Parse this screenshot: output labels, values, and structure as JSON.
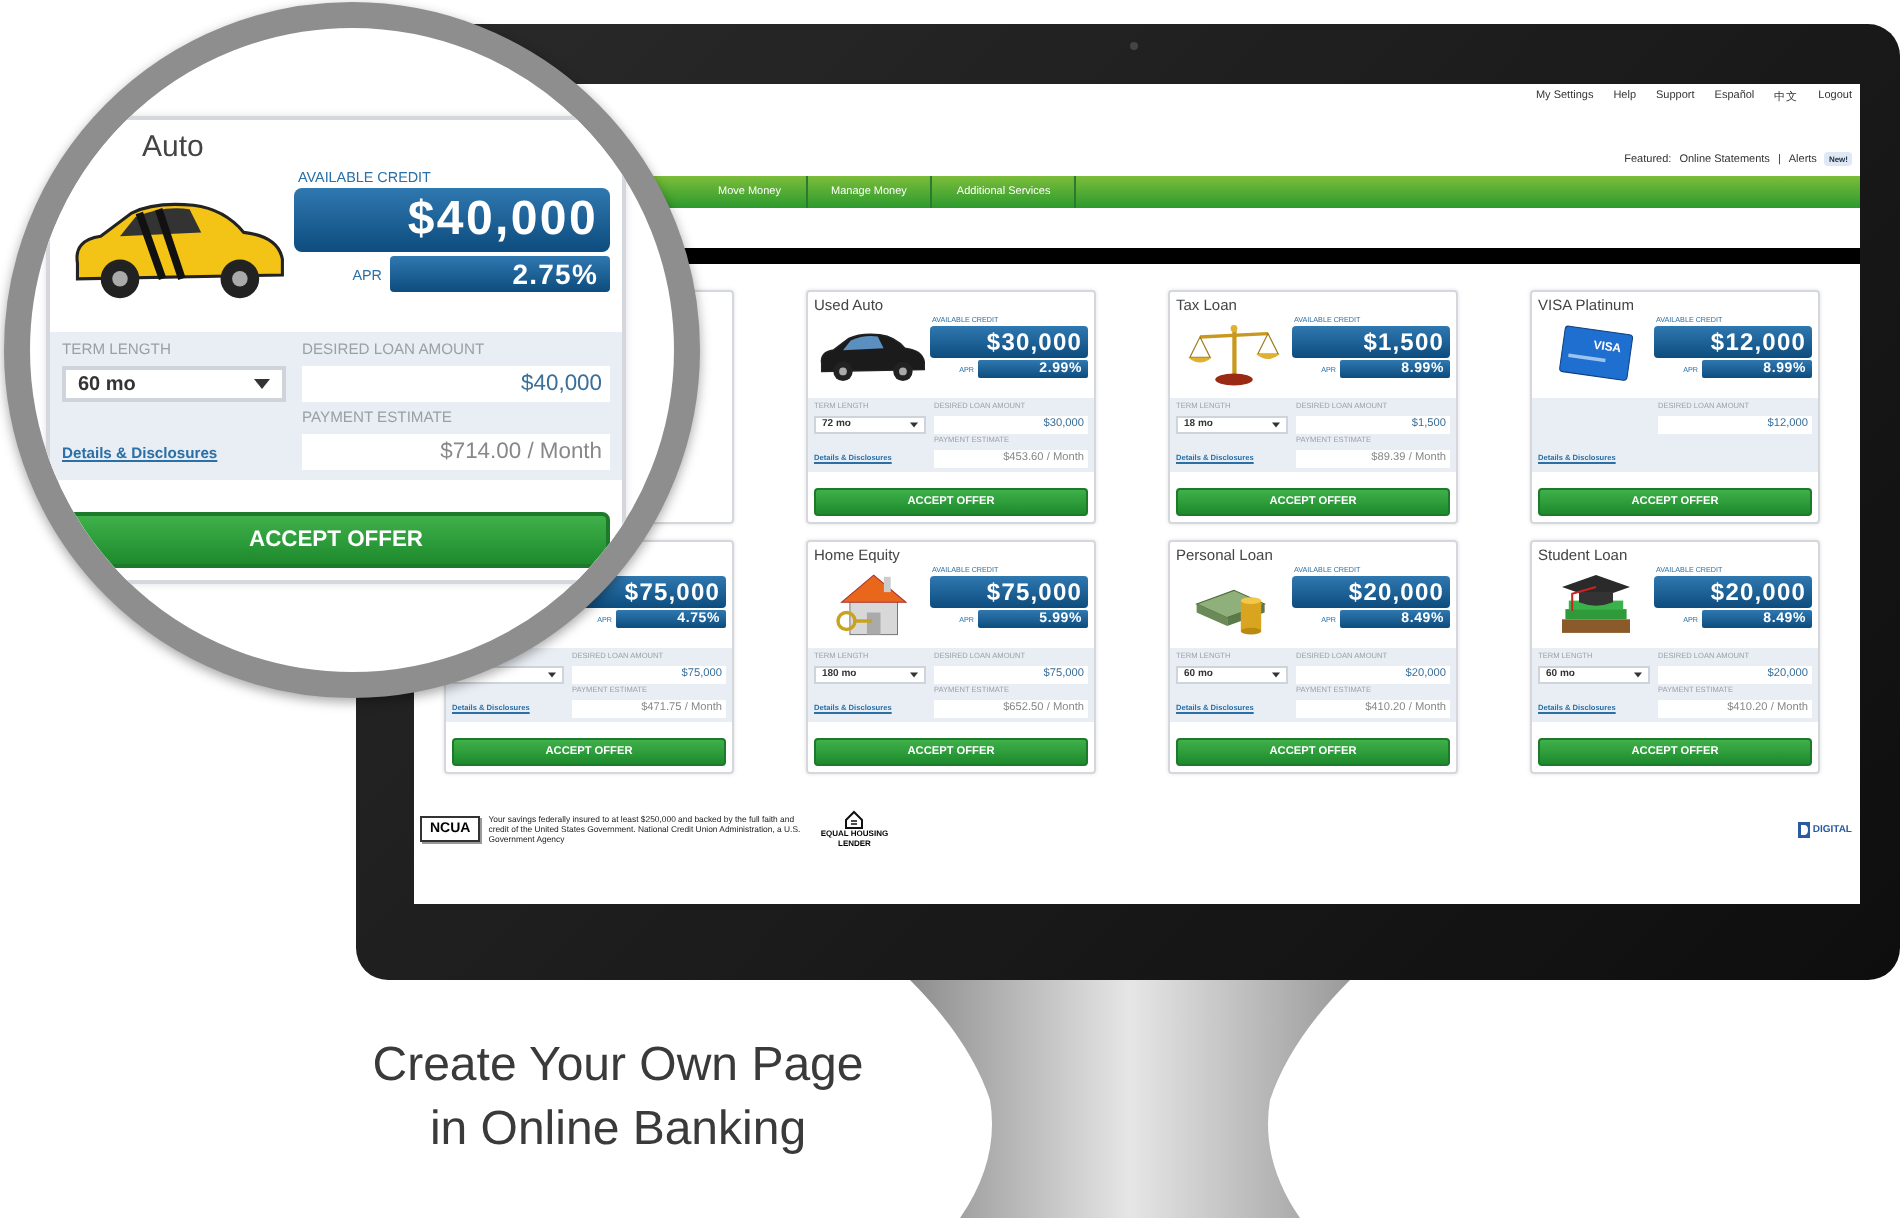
{
  "screen": {
    "top_links": [
      "My Settings",
      "Help",
      "Support",
      "Español",
      "中文",
      "Logout"
    ],
    "featured": {
      "label": "Featured:",
      "links": [
        "Online Statements",
        "Alerts"
      ],
      "separator": "|",
      "badge": "New!"
    },
    "nav": [
      "Move Money",
      "Manage Money",
      "Additional Services"
    ],
    "offers": [
      {
        "kind": "covered"
      },
      {
        "kind": "loan",
        "title": "Used Auto",
        "credit_label": "AVAILABLE CREDIT",
        "amount": "$30,000",
        "apr_label": "APR",
        "apr": "2.99%",
        "term_label": "TERM LENGTH",
        "term": "72 mo",
        "desired_label": "DESIRED LOAN AMOUNT",
        "desired": "$30,000",
        "estimate_label": "PAYMENT ESTIMATE",
        "estimate": "$453.60 / Month",
        "details": "Details & Disclosures",
        "button": "ACCEPT OFFER"
      },
      {
        "kind": "loan",
        "title": "Tax Loan",
        "credit_label": "AVAILABLE CREDIT",
        "amount": "$1,500",
        "apr_label": "APR",
        "apr": "8.99%",
        "term_label": "TERM LENGTH",
        "term": "18 mo",
        "desired_label": "DESIRED LOAN AMOUNT",
        "desired": "$1,500",
        "estimate_label": "PAYMENT ESTIMATE",
        "estimate": "$89.39 / Month",
        "details": "Details & Disclosures",
        "button": "ACCEPT OFFER"
      },
      {
        "kind": "card",
        "title": "VISA Platinum",
        "image_text": "VISA",
        "credit_label": "AVAILABLE CREDIT",
        "amount": "$12,000",
        "apr_label": "APR",
        "apr": "8.99%",
        "desired_label": "DESIRED LOAN AMOUNT",
        "desired": "$12,000",
        "details": "Details & Disclosures",
        "button": "ACCEPT OFFER"
      },
      {
        "kind": "loan",
        "amount": "$75,000",
        "apr_label": "APR",
        "apr": "4.75%",
        "desired_label": "DESIRED LOAN AMOUNT",
        "desired": "$75,000",
        "estimate_label": "PAYMENT ESTIMATE",
        "estimate": "$471.75 / Month",
        "details": "Details & Disclosures",
        "button": "ACCEPT OFFER"
      },
      {
        "kind": "loan",
        "title": "Home Equity",
        "credit_label": "AVAILABLE CREDIT",
        "amount": "$75,000",
        "apr_label": "APR",
        "apr": "5.99%",
        "term_label": "TERM LENGTH",
        "term": "180 mo",
        "desired_label": "DESIRED LOAN AMOUNT",
        "desired": "$75,000",
        "estimate_label": "PAYMENT ESTIMATE",
        "estimate": "$652.50 / Month",
        "details": "Details & Disclosures",
        "button": "ACCEPT OFFER"
      },
      {
        "kind": "loan",
        "title": "Personal Loan",
        "credit_label": "AVAILABLE CREDIT",
        "amount": "$20,000",
        "apr_label": "APR",
        "apr": "8.49%",
        "term_label": "TERM LENGTH",
        "term": "60 mo",
        "desired_label": "DESIRED LOAN AMOUNT",
        "desired": "$20,000",
        "estimate_label": "PAYMENT ESTIMATE",
        "estimate": "$410.20 / Month",
        "details": "Details & Disclosures",
        "button": "ACCEPT OFFER"
      },
      {
        "kind": "loan",
        "title": "Student Loan",
        "credit_label": "AVAILABLE CREDIT",
        "amount": "$20,000",
        "apr_label": "APR",
        "apr": "8.49%",
        "term_label": "TERM LENGTH",
        "term": "60 mo",
        "desired_label": "DESIRED LOAN AMOUNT",
        "desired": "$20,000",
        "estimate_label": "PAYMENT ESTIMATE",
        "estimate": "$410.20 / Month",
        "details": "Details & Disclosures",
        "button": "ACCEPT OFFER"
      }
    ],
    "footer": {
      "ncua": "NCUA",
      "insurance_text": "Your savings federally insured to at least $250,000 and backed by the full faith and credit of the United States Government. National Credit Union Administration, a U.S. Government Agency",
      "housing_label": "EQUAL HOUSING LENDER",
      "partner_logo": "DIGITAL"
    }
  },
  "magnifier": {
    "kind": "loan",
    "title": "Auto",
    "credit_label": "AVAILABLE CREDIT",
    "amount": "$40,000",
    "apr_label": "APR",
    "apr": "2.75%",
    "term_label": "TERM LENGTH",
    "term": "60 mo",
    "desired_label": "DESIRED LOAN AMOUNT",
    "desired": "$40,000",
    "estimate_label": "PAYMENT ESTIMATE",
    "estimate": "$714.00 / Month",
    "details": "Details & Disclosures",
    "button": "ACCEPT OFFER"
  },
  "caption": "Create Your Own Page in Online Banking"
}
